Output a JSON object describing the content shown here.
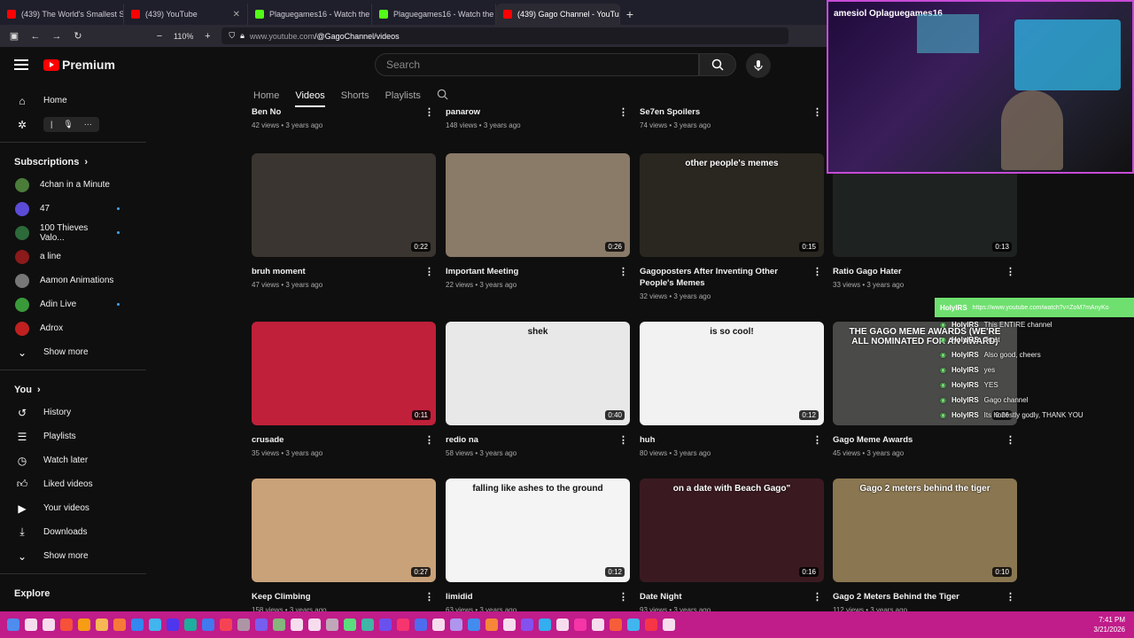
{
  "browser": {
    "tabs": [
      {
        "label": "(439) The World's Smallest Spo",
        "color": "#ff0000"
      },
      {
        "label": "(439) YouTube",
        "color": "#ff0000"
      },
      {
        "label": "Plaguegames16 - Watch the V",
        "color": "#53fc18"
      },
      {
        "label": "Plaguegames16 - Watch the V",
        "color": "#53fc18"
      },
      {
        "label": "(439) Gago Channel - YouTube",
        "color": "#ff0000",
        "active": true
      }
    ],
    "zoom": "110%",
    "url_host": "www.youtube.com",
    "url_path": "/@GagoChannel/videos"
  },
  "masthead": {
    "logo": "Premium",
    "search_placeholder": "Search"
  },
  "sidebar": {
    "home": "Home",
    "subscriptions_label": "Subscriptions",
    "subscriptions": [
      {
        "name": "4chan in a Minute",
        "color": "#4a7c3a",
        "dot": false
      },
      {
        "name": "47",
        "color": "#5b4bd6",
        "dot": true
      },
      {
        "name": "100 Thieves Valo...",
        "color": "#2d6a3a",
        "dot": true
      },
      {
        "name": "a line",
        "color": "#8b1a1a",
        "dot": false
      },
      {
        "name": "Aamon Animations",
        "color": "#777777",
        "dot": false
      },
      {
        "name": "Adin Live",
        "color": "#3a9a3a",
        "dot": true
      },
      {
        "name": "Adrox",
        "color": "#c02020",
        "dot": false
      }
    ],
    "show_more": "Show more",
    "you_label": "You",
    "you_items": [
      {
        "name": "History",
        "icon": "history-icon"
      },
      {
        "name": "Playlists",
        "icon": "playlists-icon"
      },
      {
        "name": "Watch later",
        "icon": "watch-later-icon"
      },
      {
        "name": "Liked videos",
        "icon": "like-icon"
      },
      {
        "name": "Your videos",
        "icon": "your-videos-icon"
      },
      {
        "name": "Downloads",
        "icon": "download-icon"
      }
    ],
    "show_more_2": "Show more",
    "explore_label": "Explore"
  },
  "channel_tabs": [
    "Home",
    "Videos",
    "Shorts",
    "Playlists"
  ],
  "top_row": [
    {
      "title": "Ben No",
      "meta": "42 views • 3 years ago"
    },
    {
      "title": "panarow",
      "meta": "148 views • 3 years ago"
    },
    {
      "title": "Se7en Spoilers",
      "meta": "74 views • 3 years ago"
    }
  ],
  "videos": [
    {
      "title": "bruh moment",
      "meta": "47 views • 3 years ago",
      "duration": "0:22",
      "bg": "#3a3530",
      "caption": ""
    },
    {
      "title": "Important Meeting",
      "meta": "22 views • 3 years ago",
      "duration": "0:26",
      "bg": "#8a7a68",
      "caption": ""
    },
    {
      "title": "Gagoposters After Inventing Other People's Memes",
      "meta": "32 views • 3 years ago",
      "duration": "0:15",
      "bg": "#2a2620",
      "caption": "other people's memes"
    },
    {
      "title": "Ratio Gago Hater",
      "meta": "33 views • 3 years ago",
      "duration": "0:13",
      "bg": "#1e2220",
      "caption": ""
    },
    {
      "title": "crusade",
      "meta": "35 views • 3 years ago",
      "duration": "0:11",
      "bg": "#c0203a",
      "caption": ""
    },
    {
      "title": "redio na",
      "meta": "58 views • 3 years ago",
      "duration": "0:40",
      "bg": "#e8e8e8",
      "caption": "shek"
    },
    {
      "title": "huh",
      "meta": "80 views • 3 years ago",
      "duration": "0:12",
      "bg": "#f2f2f2",
      "caption": "is so cool!"
    },
    {
      "title": "Gago Meme Awards",
      "meta": "45 views • 3 years ago",
      "duration": "0:26",
      "bg": "#4a4a48",
      "caption": "THE GAGO MEME AWARDS (WE'RE ALL NOMINATED FOR AN AWARD)"
    },
    {
      "title": "Keep Climbing",
      "meta": "158 views • 3 years ago",
      "duration": "0:27",
      "bg": "#c9a27a",
      "caption": ""
    },
    {
      "title": "limidid",
      "meta": "63 views • 3 years ago",
      "duration": "0:12",
      "bg": "#f4f4f4",
      "caption": "falling like ashes to the ground"
    },
    {
      "title": "Date Night",
      "meta": "93 views • 3 years ago",
      "duration": "0:16",
      "bg": "#3a1a20",
      "caption": "on a date with Beach Gago\""
    },
    {
      "title": "Gago 2 Meters Behind the Tiger",
      "meta": "112 views • 3 years ago",
      "duration": "0:10",
      "bg": "#8a7650",
      "caption": "Gago 2 meters behind the tiger"
    }
  ],
  "stream": {
    "cam_label": "amesiol Oplaguegames16"
  },
  "chat": {
    "header_user": "HolyIRS",
    "header_text": "https://www.youtube.com/watch?v=ZoM7mAnyKo",
    "lines": [
      {
        "user": "HolyIRS",
        "text": "This ENTIRE channel"
      },
      {
        "user": "HolyIRS",
        "text": "Trust"
      },
      {
        "user": "HolyIRS",
        "text": "Also good, cheers"
      },
      {
        "user": "HolyIRS",
        "text": "yes"
      },
      {
        "user": "HolyIRS",
        "text": "YES"
      },
      {
        "user": "HolyIRS",
        "text": "Gago channel"
      },
      {
        "user": "HolyIRS",
        "text": "Its honestly godly, THANK YOU"
      }
    ]
  },
  "taskbar": {
    "time": "7:41 PM",
    "date": "3/21/2026"
  }
}
